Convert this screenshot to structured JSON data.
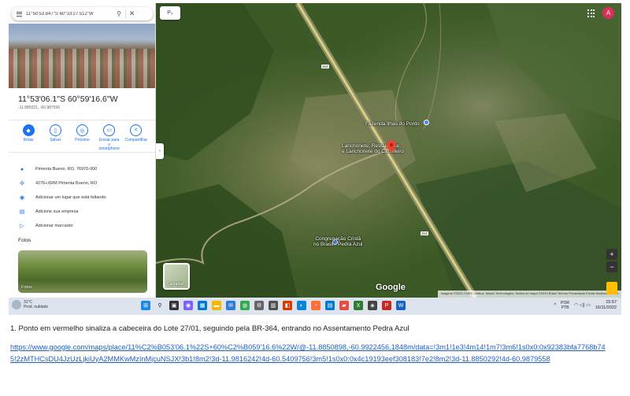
{
  "search": {
    "value": "11°50'53.847\"S 60°33'27.512\"W",
    "close_glyph": "✕"
  },
  "place": {
    "title": "11°53'06.1\"S 60°59'16.6\"W",
    "subtitle": "-11.885021, -60.987556"
  },
  "actions": [
    {
      "label": "Rotas",
      "icon": "directions-icon",
      "glyph": "◆"
    },
    {
      "label": "Salvar",
      "icon": "bookmark-icon",
      "glyph": "▯"
    },
    {
      "label": "Próximo",
      "icon": "nearby-icon",
      "glyph": "◎"
    },
    {
      "label": "Enviar para o smartphone",
      "icon": "send-to-phone-icon",
      "glyph": "▭"
    },
    {
      "label": "Compartilhar",
      "icon": "share-icon",
      "glyph": "<"
    }
  ],
  "info": [
    {
      "text": "Pimenta Bueno, RO, 76970-000",
      "icon": "location-pin-icon",
      "glyph": "●"
    },
    {
      "text": "4276+XRM Pimenta Bueno, RO",
      "icon": "plus-code-icon",
      "glyph": "✣"
    },
    {
      "text": "Adicionar um lugar que está faltando",
      "icon": "add-place-icon",
      "glyph": "◉"
    },
    {
      "text": "Adicione sua empresa",
      "icon": "business-icon",
      "glyph": "▤"
    },
    {
      "text": "Adicionar marcador",
      "icon": "label-icon",
      "glyph": "▷"
    }
  ],
  "photos": {
    "heading": "Fotos",
    "thumb_label": "Fotos"
  },
  "map": {
    "layers_label": "P₅",
    "labels": {
      "fazenda": "Fazenda Ilhas do Ponto",
      "lanchonete": "Lanchonete, Restaurante\ne Lanchonete do Carreteiro",
      "igreja": "Congregação Cristã\nno Brasil - Pedra Azul"
    },
    "road_shield": "364",
    "satellite_label": "Camadas",
    "logo": "Google",
    "attribution": "Imagens ©2022 CNES / Airbus, Maxar Technologies, Dados do mapa ©2022   Brasil   Termos   Privacidade   Enviar feedback   100 m",
    "account_initial": "A",
    "zoom_in": "+",
    "zoom_out": "−",
    "pin_color": "#ea4335"
  },
  "taskbar": {
    "weather_temp": "31°C",
    "weather_desc": "Prod. nublado",
    "lang_top": "POR",
    "lang_bottom": "PTB",
    "time": "15:57",
    "date": "16/11/2022"
  },
  "document": {
    "caption": "1. Ponto em vermelho sinaliza a cabeceira do Lote 27/01, seguindo pela BR-364, entrando no Assentamento Pedra Azul",
    "link": "https://www.google.com/maps/place/11%C2%B053'06.1%22S+60%C2%B059'16.6%22W/@-11.8850898,-60.9922456,1848m/data=!3m1!1e3!4m14!1m7!3m6!1s0x0:0x92383bfa7768b745!2zMTHCsDU4JzUzLjkiUyA2MMKwMzInMjcuNSJX!3b1!8m2!3d-11.9816242!4d-60.5409756!3m5!1s0x0:0x4c19193eef308183!7e2!8m2!3d-11.8850292!4d-60.9879558"
  }
}
